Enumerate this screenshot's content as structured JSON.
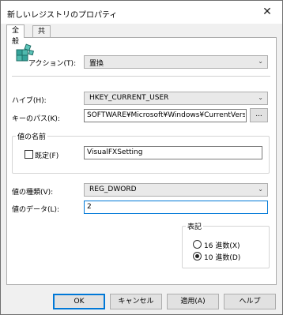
{
  "window": {
    "title": "新しいレジストリのプロパティ",
    "close_glyph": "✕"
  },
  "tabs": [
    {
      "label": "全般"
    },
    {
      "label": "共通"
    }
  ],
  "action": {
    "label": "アクション(T):",
    "value": "置換"
  },
  "hive": {
    "label": "ハイブ(H):",
    "value": "HKEY_CURRENT_USER"
  },
  "key_path": {
    "label": "キーのパス(K):",
    "value": "SOFTWARE¥Microsoft¥Windows¥CurrentVersion¥",
    "browse_label": "..."
  },
  "value_name": {
    "group_label": "値の名前",
    "default_label": "既定(F)",
    "value": "VisualFXSetting"
  },
  "value_type": {
    "label": "値の種類(V):",
    "value": "REG_DWORD"
  },
  "value_data": {
    "label": "値のデータ(L):",
    "value": "2"
  },
  "base": {
    "group_label": "表記",
    "options": [
      {
        "label": "16 進数(X)"
      },
      {
        "label": "10 進数(D)"
      }
    ],
    "selected": "10 進数(D)"
  },
  "buttons": {
    "ok": "OK",
    "cancel": "キャンセル",
    "apply": "適用(A)",
    "help": "ヘルプ"
  },
  "colors": {
    "accent": "#0078d7"
  }
}
